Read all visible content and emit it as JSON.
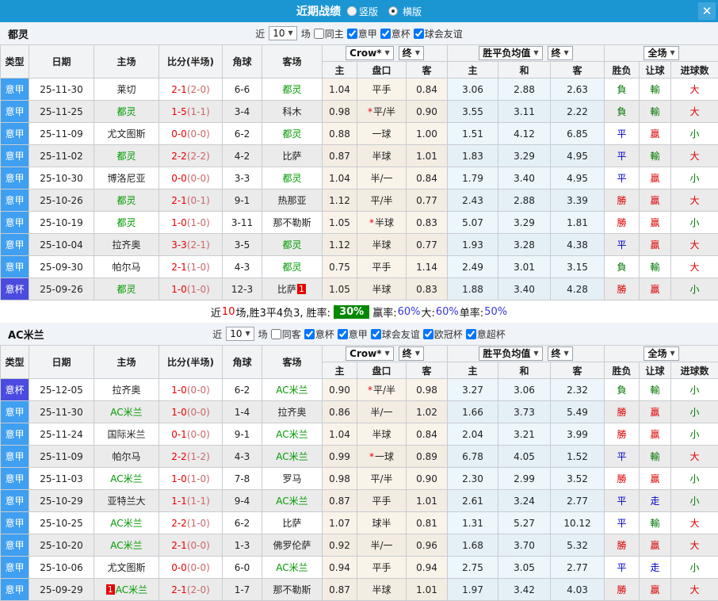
{
  "titlebar": {
    "title": "近期战绩",
    "radios": [
      {
        "label": "竖版",
        "selected": false
      },
      {
        "label": "横版",
        "selected": true
      }
    ],
    "close_label": "✕"
  },
  "colors": {
    "titlebar_bg": "#1c96d3",
    "league_type_bg": "#3f9ff0",
    "cup_type_bg": "#4b4be0",
    "self_team_green": "#009900",
    "score_red": "#e80000",
    "win_red": "#dd0000",
    "draw_blue": "#0000cc",
    "lose_green": "#007700",
    "summary_badge_bg": "#008800",
    "summary_pct_blue": "#3535e0"
  },
  "table": {
    "selects": {
      "odds_source": "Crow*",
      "time_final": "终",
      "avg": "胜平负均值",
      "time_final2": "终",
      "scope": "全场"
    },
    "columns_left": [
      "类型",
      "日期",
      "主场",
      "比分(半场)",
      "角球",
      "客场"
    ],
    "columns_odds": [
      "主",
      "盘口",
      "客"
    ],
    "columns_euro": [
      "主",
      "和",
      "客"
    ],
    "columns_right": [
      "胜负",
      "让球",
      "进球数"
    ]
  },
  "result_colors": {
    "勝": "#dd0000",
    "平": "#0000cc",
    "負": "#007700",
    "贏": "#dd0000",
    "輸": "#007700",
    "走": "#0000cc",
    "大": "#dd0000",
    "小": "#007700"
  },
  "row_fields": [
    "type",
    "is_cup",
    "date",
    "home",
    "home_is_self",
    "home_badge",
    "score",
    "half_score",
    "corners",
    "away",
    "away_is_self",
    "away_badge",
    "odds_home",
    "handicap_star",
    "handicap",
    "odds_away",
    "euro_home",
    "euro_draw",
    "euro_away",
    "result",
    "handicap_result",
    "goals_result"
  ],
  "sections": [
    {
      "team": "都灵",
      "filter": {
        "prefix": "近",
        "count": "10",
        "suffix": "场"
      },
      "checkboxes": [
        {
          "label": "同主",
          "checked": false
        },
        {
          "label": "意甲",
          "checked": true
        },
        {
          "label": "意杯",
          "checked": true
        },
        {
          "label": "球会友谊",
          "checked": true
        }
      ],
      "rows": [
        [
          "意甲",
          false,
          "25-11-30",
          "莱切",
          false,
          "",
          "2-1",
          "(2-0)",
          "6-6",
          "都灵",
          true,
          "",
          "1.04",
          false,
          "平手",
          "0.84",
          "3.06",
          "2.88",
          "2.63",
          "負",
          "輸",
          "大"
        ],
        [
          "意甲",
          false,
          "25-11-25",
          "都灵",
          true,
          "",
          "1-5",
          "(1-1)",
          "3-4",
          "科木",
          false,
          "",
          "0.98",
          true,
          "平/半",
          "0.90",
          "3.55",
          "3.11",
          "2.22",
          "負",
          "輸",
          "大"
        ],
        [
          "意甲",
          false,
          "25-11-09",
          "尤文图斯",
          false,
          "",
          "0-0",
          "(0-0)",
          "6-2",
          "都灵",
          true,
          "",
          "0.88",
          false,
          "一球",
          "1.00",
          "1.51",
          "4.12",
          "6.85",
          "平",
          "贏",
          "小"
        ],
        [
          "意甲",
          false,
          "25-11-02",
          "都灵",
          true,
          "",
          "2-2",
          "(2-2)",
          "4-2",
          "比萨",
          false,
          "",
          "0.87",
          false,
          "半球",
          "1.01",
          "1.83",
          "3.29",
          "4.95",
          "平",
          "輸",
          "大"
        ],
        [
          "意甲",
          false,
          "25-10-30",
          "博洛尼亚",
          false,
          "",
          "0-0",
          "(0-0)",
          "3-3",
          "都灵",
          true,
          "",
          "1.04",
          false,
          "半/一",
          "0.84",
          "1.79",
          "3.40",
          "4.95",
          "平",
          "贏",
          "小"
        ],
        [
          "意甲",
          false,
          "25-10-26",
          "都灵",
          true,
          "",
          "2-1",
          "(0-1)",
          "9-1",
          "热那亚",
          false,
          "",
          "1.12",
          false,
          "平/半",
          "0.77",
          "2.43",
          "2.88",
          "3.39",
          "勝",
          "贏",
          "大"
        ],
        [
          "意甲",
          false,
          "25-10-19",
          "都灵",
          true,
          "",
          "1-0",
          "(1-0)",
          "3-11",
          "那不勒斯",
          false,
          "",
          "1.05",
          true,
          "半球",
          "0.83",
          "5.07",
          "3.29",
          "1.81",
          "勝",
          "贏",
          "小"
        ],
        [
          "意甲",
          false,
          "25-10-04",
          "拉齐奥",
          false,
          "",
          "3-3",
          "(2-1)",
          "3-5",
          "都灵",
          true,
          "",
          "1.12",
          false,
          "半球",
          "0.77",
          "1.93",
          "3.28",
          "4.38",
          "平",
          "贏",
          "大"
        ],
        [
          "意甲",
          false,
          "25-09-30",
          "帕尔马",
          false,
          "",
          "2-1",
          "(1-0)",
          "4-3",
          "都灵",
          true,
          "",
          "0.75",
          false,
          "平手",
          "1.14",
          "2.49",
          "3.01",
          "3.15",
          "負",
          "輸",
          "大"
        ],
        [
          "意杯",
          true,
          "25-09-26",
          "都灵",
          true,
          "",
          "1-0",
          "(1-0)",
          "12-3",
          "比萨",
          false,
          "1",
          "1.05",
          false,
          "半球",
          "0.83",
          "1.88",
          "3.40",
          "4.28",
          "勝",
          "贏",
          "小"
        ]
      ],
      "summary": [
        {
          "t": "近",
          "s": "k"
        },
        {
          "t": "10",
          "s": "red"
        },
        {
          "t": "场,胜3平4负3, 胜率:",
          "s": "k"
        },
        {
          "t": "30%",
          "s": "badge"
        },
        {
          "t": "赢率:",
          "s": "k"
        },
        {
          "t": "60%",
          "s": "blue"
        },
        {
          "t": " 大:",
          "s": "k"
        },
        {
          "t": "60%",
          "s": "blue"
        },
        {
          "t": " 单率:",
          "s": "k"
        },
        {
          "t": "50%",
          "s": "blue"
        }
      ]
    },
    {
      "team": "AC米兰",
      "filter": {
        "prefix": "近",
        "count": "10",
        "suffix": "场"
      },
      "checkboxes": [
        {
          "label": "同客",
          "checked": false
        },
        {
          "label": "意杯",
          "checked": true
        },
        {
          "label": "意甲",
          "checked": true
        },
        {
          "label": "球会友谊",
          "checked": true
        },
        {
          "label": "欧冠杯",
          "checked": true
        },
        {
          "label": "意超杯",
          "checked": true
        }
      ],
      "rows": [
        [
          "意杯",
          true,
          "25-12-05",
          "拉齐奥",
          false,
          "",
          "1-0",
          "(0-0)",
          "6-2",
          "AC米兰",
          true,
          "",
          "0.90",
          true,
          "平/半",
          "0.98",
          "3.27",
          "3.06",
          "2.32",
          "負",
          "輸",
          "小"
        ],
        [
          "意甲",
          false,
          "25-11-30",
          "AC米兰",
          true,
          "",
          "1-0",
          "(0-0)",
          "1-4",
          "拉齐奥",
          false,
          "",
          "0.86",
          false,
          "半/一",
          "1.02",
          "1.66",
          "3.73",
          "5.49",
          "勝",
          "贏",
          "小"
        ],
        [
          "意甲",
          false,
          "25-11-24",
          "国际米兰",
          false,
          "",
          "0-1",
          "(0-0)",
          "9-1",
          "AC米兰",
          true,
          "",
          "1.04",
          false,
          "半球",
          "0.84",
          "2.04",
          "3.21",
          "3.99",
          "勝",
          "贏",
          "小"
        ],
        [
          "意甲",
          false,
          "25-11-09",
          "帕尔马",
          false,
          "",
          "2-2",
          "(1-2)",
          "4-3",
          "AC米兰",
          true,
          "",
          "0.99",
          true,
          "一球",
          "0.89",
          "6.78",
          "4.05",
          "1.52",
          "平",
          "輸",
          "大"
        ],
        [
          "意甲",
          false,
          "25-11-03",
          "AC米兰",
          true,
          "",
          "1-0",
          "(1-0)",
          "7-8",
          "罗马",
          false,
          "",
          "0.98",
          false,
          "平/半",
          "0.90",
          "2.30",
          "2.99",
          "3.52",
          "勝",
          "贏",
          "小"
        ],
        [
          "意甲",
          false,
          "25-10-29",
          "亚特兰大",
          false,
          "",
          "1-1",
          "(1-1)",
          "9-4",
          "AC米兰",
          true,
          "",
          "0.87",
          false,
          "平手",
          "1.01",
          "2.61",
          "3.24",
          "2.77",
          "平",
          "走",
          "小"
        ],
        [
          "意甲",
          false,
          "25-10-25",
          "AC米兰",
          true,
          "",
          "2-2",
          "(1-0)",
          "6-2",
          "比萨",
          false,
          "",
          "1.07",
          false,
          "球半",
          "0.81",
          "1.31",
          "5.27",
          "10.12",
          "平",
          "輸",
          "大"
        ],
        [
          "意甲",
          false,
          "25-10-20",
          "AC米兰",
          true,
          "",
          "2-1",
          "(0-0)",
          "1-3",
          "佛罗伦萨",
          false,
          "",
          "0.92",
          false,
          "半/一",
          "0.96",
          "1.68",
          "3.70",
          "5.32",
          "勝",
          "贏",
          "大"
        ],
        [
          "意甲",
          false,
          "25-10-06",
          "尤文图斯",
          false,
          "",
          "0-0",
          "(0-0)",
          "6-0",
          "AC米兰",
          true,
          "",
          "0.94",
          false,
          "平手",
          "0.94",
          "2.75",
          "3.05",
          "2.77",
          "平",
          "走",
          "小"
        ],
        [
          "意甲",
          false,
          "25-09-29",
          "AC米兰",
          true,
          "1",
          "2-1",
          "(2-0)",
          "1-7",
          "那不勒斯",
          false,
          "",
          "0.87",
          false,
          "半球",
          "1.01",
          "1.97",
          "3.42",
          "4.03",
          "勝",
          "贏",
          "大"
        ]
      ],
      "summary": null
    }
  ]
}
